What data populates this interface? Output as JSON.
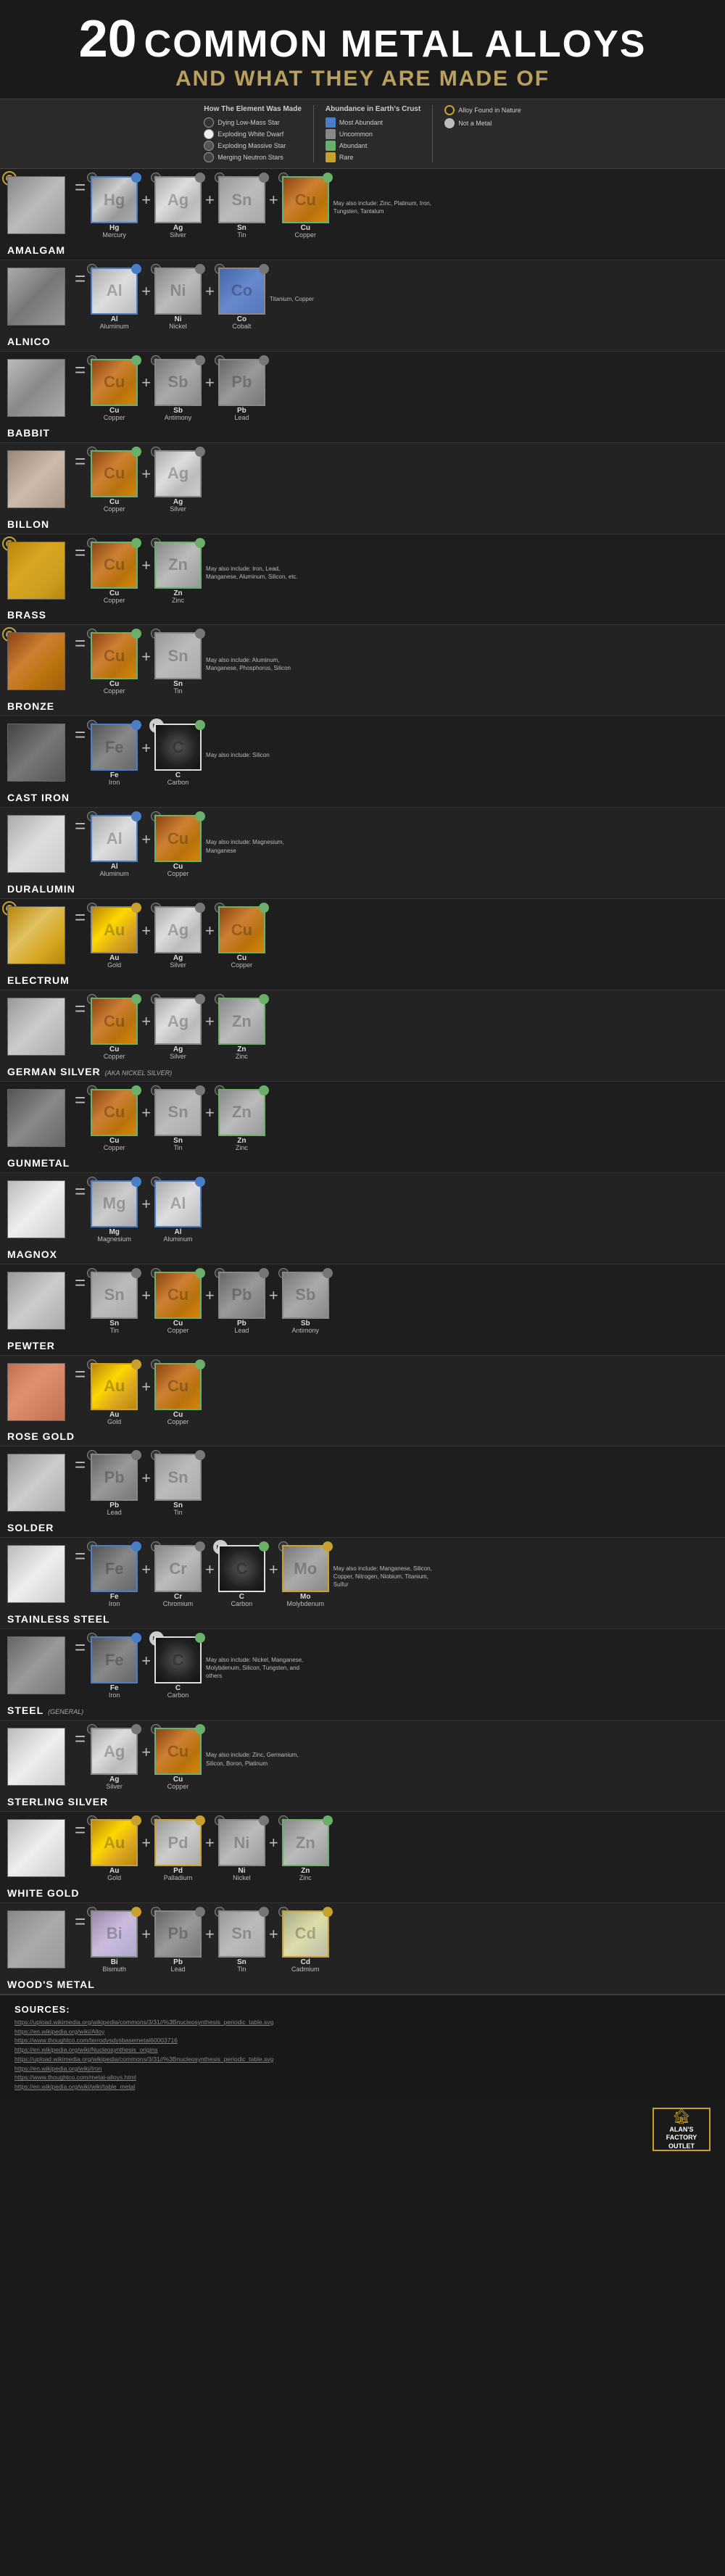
{
  "header": {
    "number": "20",
    "title": "COMMON METAL ALLOYS",
    "subtitle": "AND WHAT THEY ARE MADE OF"
  },
  "legend": {
    "how_title": "How The Element Was Made",
    "how_items": [
      {
        "label": "Dying Low-Mass Star",
        "icon": "circle-dark"
      },
      {
        "label": "Exploding White Dwarf",
        "icon": "circle-white"
      },
      {
        "label": "Exploding Massive Star",
        "icon": "circle-medium"
      },
      {
        "label": "Merging Neutron Stars",
        "icon": "circle-neutron"
      }
    ],
    "abundance_title": "Abundance in Earth's Crust",
    "abundance_items": [
      {
        "label": "Most Abundant",
        "color": "blue"
      },
      {
        "label": "Uncommon",
        "color": "gray"
      },
      {
        "label": "Abundant",
        "color": "green"
      },
      {
        "label": "Rare",
        "color": "gold"
      }
    ],
    "alloy_items": [
      {
        "label": "Alloy Found in Nature"
      },
      {
        "label": "Not a Metal"
      }
    ]
  },
  "alloy_found_label": "Alloy Found Nature Not Metal",
  "alloys": [
    {
      "name": "AMALGAM",
      "aka": "",
      "nature": true,
      "texture": "tex-amalgam",
      "elements": [
        {
          "sym": "Hg",
          "name": "Mercury",
          "tex": "tex-mercury",
          "border": "b-blue",
          "abund": "ad-blue",
          "how": "★"
        },
        {
          "sym": "Ag",
          "name": "Silver",
          "tex": "tex-silver",
          "border": "b-gray",
          "abund": "ad-gray",
          "how": "✦"
        },
        {
          "sym": "Sn",
          "name": "Tin",
          "tex": "tex-tin",
          "border": "b-gray",
          "abund": "ad-gray",
          "how": "✦"
        },
        {
          "sym": "Cu",
          "name": "Copper",
          "tex": "tex-copper",
          "border": "b-green",
          "abund": "ad-green",
          "how": "✦"
        }
      ],
      "may_also": "May also include: Zinc, Platinum, Iron, Tungsten, Tantalum"
    },
    {
      "name": "ALNICO",
      "aka": "",
      "nature": false,
      "texture": "tex-alnico",
      "elements": [
        {
          "sym": "Al",
          "name": "Aluminum",
          "tex": "tex-aluminum",
          "border": "b-blue",
          "abund": "ad-blue",
          "how": "★"
        },
        {
          "sym": "Ni",
          "name": "Nickel",
          "tex": "tex-nickel",
          "border": "b-gray",
          "abund": "ad-gray",
          "how": "✦"
        },
        {
          "sym": "Co",
          "name": "Cobalt",
          "tex": "tex-cobalt",
          "border": "b-gray",
          "abund": "ad-gray",
          "how": "✦"
        }
      ],
      "may_also": "Titanium, Copper"
    },
    {
      "name": "BABBIT",
      "aka": "",
      "nature": false,
      "texture": "tex-babbit",
      "elements": [
        {
          "sym": "Cu",
          "name": "Copper",
          "tex": "tex-copper",
          "border": "b-green",
          "abund": "ad-green",
          "how": "✦"
        },
        {
          "sym": "Sb",
          "name": "Antimony",
          "tex": "tex-antimony",
          "border": "b-gray",
          "abund": "ad-gray",
          "how": "✦"
        },
        {
          "sym": "Pb",
          "name": "Lead",
          "tex": "tex-lead",
          "border": "b-gray",
          "abund": "ad-gray",
          "how": "✦"
        }
      ],
      "may_also": ""
    },
    {
      "name": "BILLON",
      "aka": "",
      "nature": false,
      "texture": "tex-billon",
      "elements": [
        {
          "sym": "Cu",
          "name": "Copper",
          "tex": "tex-copper",
          "border": "b-green",
          "abund": "ad-green",
          "how": "✦"
        },
        {
          "sym": "Ag",
          "name": "Silver",
          "tex": "tex-silver",
          "border": "b-gray",
          "abund": "ad-gray",
          "how": "✦"
        }
      ],
      "may_also": ""
    },
    {
      "name": "BRASS",
      "aka": "",
      "nature": true,
      "texture": "tex-brass",
      "elements": [
        {
          "sym": "Cu",
          "name": "Copper",
          "tex": "tex-copper",
          "border": "b-green",
          "abund": "ad-green",
          "how": "✦"
        },
        {
          "sym": "Zn",
          "name": "Zinc",
          "tex": "tex-zinc",
          "border": "b-green",
          "abund": "ad-green",
          "how": "✦"
        }
      ],
      "may_also": "May also include: Iron, Lead, Manganese, Aluminum, Silicon, etc."
    },
    {
      "name": "BRONZE",
      "aka": "",
      "nature": true,
      "texture": "tex-bronze",
      "elements": [
        {
          "sym": "Cu",
          "name": "Copper",
          "tex": "tex-copper",
          "border": "b-green",
          "abund": "ad-green",
          "how": "✦"
        },
        {
          "sym": "Sn",
          "name": "Tin",
          "tex": "tex-tin",
          "border": "b-gray",
          "abund": "ad-gray",
          "how": "✦"
        }
      ],
      "may_also": "May also include: Aluminum, Manganese, Phosphorus, Silicon"
    },
    {
      "name": "CAST IRON",
      "aka": "",
      "nature": false,
      "texture": "tex-cast-iron",
      "elements": [
        {
          "sym": "Fe",
          "name": "Iron",
          "tex": "tex-iron",
          "border": "b-blue",
          "abund": "ad-blue",
          "how": "★"
        },
        {
          "sym": "C",
          "name": "Carbon",
          "tex": "tex-carbon",
          "border": "b-white",
          "abund": "ad-green",
          "how": "★",
          "not_metal": true
        }
      ],
      "may_also": "May also include: Silicon"
    },
    {
      "name": "DURALUMIN",
      "aka": "",
      "nature": false,
      "texture": "tex-duralumin",
      "elements": [
        {
          "sym": "Al",
          "name": "Aluminum",
          "tex": "tex-aluminum",
          "border": "b-blue",
          "abund": "ad-blue",
          "how": "★"
        },
        {
          "sym": "Cu",
          "name": "Copper",
          "tex": "tex-copper",
          "border": "b-green",
          "abund": "ad-green",
          "how": "✦"
        }
      ],
      "may_also": "May also include: Magnesium, Manganese"
    },
    {
      "name": "ELECTRUM",
      "aka": "",
      "nature": true,
      "texture": "tex-electrum",
      "elements": [
        {
          "sym": "Au",
          "name": "Gold",
          "tex": "tex-gold",
          "border": "b-gray",
          "abund": "ad-gold",
          "how": "✦"
        },
        {
          "sym": "Ag",
          "name": "Silver",
          "tex": "tex-silver",
          "border": "b-gray",
          "abund": "ad-gray",
          "how": "✦"
        },
        {
          "sym": "Cu",
          "name": "Copper",
          "tex": "tex-copper",
          "border": "b-green",
          "abund": "ad-green",
          "how": "✦"
        }
      ],
      "may_also": ""
    },
    {
      "name": "GERMAN SILVER",
      "aka": "(AKA NICKEL SILVER)",
      "nature": false,
      "texture": "tex-german-silver",
      "elements": [
        {
          "sym": "Cu",
          "name": "Copper",
          "tex": "tex-copper",
          "border": "b-green",
          "abund": "ad-green",
          "how": "✦"
        },
        {
          "sym": "Ag",
          "name": "Silver",
          "tex": "tex-silver",
          "border": "b-gray",
          "abund": "ad-gray",
          "how": "✦"
        },
        {
          "sym": "Zn",
          "name": "Zinc",
          "tex": "tex-zinc",
          "border": "b-green",
          "abund": "ad-green",
          "how": "✦"
        }
      ],
      "may_also": ""
    },
    {
      "name": "GUNMETAL",
      "aka": "",
      "nature": false,
      "texture": "tex-gunmetal",
      "elements": [
        {
          "sym": "Cu",
          "name": "Copper",
          "tex": "tex-copper",
          "border": "b-green",
          "abund": "ad-green",
          "how": "✦"
        },
        {
          "sym": "Sn",
          "name": "Tin",
          "tex": "tex-tin",
          "border": "b-gray",
          "abund": "ad-gray",
          "how": "✦"
        },
        {
          "sym": "Zn",
          "name": "Zinc",
          "tex": "tex-zinc",
          "border": "b-green",
          "abund": "ad-green",
          "how": "✦"
        }
      ],
      "may_also": ""
    },
    {
      "name": "MAGNOX",
      "aka": "",
      "nature": false,
      "texture": "tex-magnox",
      "elements": [
        {
          "sym": "Mg",
          "name": "Magnesium",
          "tex": "tex-magnesium",
          "border": "b-blue",
          "abund": "ad-blue",
          "how": "✦"
        },
        {
          "sym": "Al",
          "name": "Aluminum",
          "tex": "tex-aluminum",
          "border": "b-blue",
          "abund": "ad-blue",
          "how": "★"
        }
      ],
      "may_also": ""
    },
    {
      "name": "PEWTER",
      "aka": "",
      "nature": false,
      "texture": "tex-pewter",
      "elements": [
        {
          "sym": "Sn",
          "name": "Tin",
          "tex": "tex-tin",
          "border": "b-gray",
          "abund": "ad-gray",
          "how": "✦"
        },
        {
          "sym": "Cu",
          "name": "Copper",
          "tex": "tex-copper",
          "border": "b-green",
          "abund": "ad-green",
          "how": "✦"
        },
        {
          "sym": "Pb",
          "name": "Lead",
          "tex": "tex-lead",
          "border": "b-gray",
          "abund": "ad-gray",
          "how": "✦"
        },
        {
          "sym": "Sb",
          "name": "Antimony",
          "tex": "tex-antimony",
          "border": "b-gray",
          "abund": "ad-gray",
          "how": "✦"
        }
      ],
      "may_also": ""
    },
    {
      "name": "ROSE GOLD",
      "aka": "",
      "nature": false,
      "texture": "tex-rose-gold",
      "elements": [
        {
          "sym": "Au",
          "name": "Gold",
          "tex": "tex-gold",
          "border": "b-gold",
          "abund": "ad-gold",
          "how": "✦"
        },
        {
          "sym": "Cu",
          "name": "Copper",
          "tex": "tex-copper",
          "border": "b-green",
          "abund": "ad-green",
          "how": "✦"
        }
      ],
      "may_also": ""
    },
    {
      "name": "SOLDER",
      "aka": "",
      "nature": false,
      "texture": "tex-solder",
      "elements": [
        {
          "sym": "Pb",
          "name": "Lead",
          "tex": "tex-lead",
          "border": "b-gray",
          "abund": "ad-gray",
          "how": "✦"
        },
        {
          "sym": "Sn",
          "name": "Tin",
          "tex": "tex-tin",
          "border": "b-gray",
          "abund": "ad-gray",
          "how": "✦"
        }
      ],
      "may_also": ""
    },
    {
      "name": "STAINLESS STEEL",
      "aka": "",
      "nature": false,
      "texture": "tex-stainless",
      "elements": [
        {
          "sym": "Fe",
          "name": "Iron",
          "tex": "tex-iron",
          "border": "b-blue",
          "abund": "ad-blue",
          "how": "★"
        },
        {
          "sym": "Cr",
          "name": "Chromium",
          "tex": "tex-chromium",
          "border": "b-gray",
          "abund": "ad-gray",
          "how": "★"
        },
        {
          "sym": "C",
          "name": "Carbon",
          "tex": "tex-carbon",
          "border": "b-white",
          "abund": "ad-green",
          "how": "★",
          "not_metal": true
        },
        {
          "sym": "Mo",
          "name": "Molybdenum",
          "tex": "tex-molybdenum",
          "border": "b-gold",
          "abund": "ad-gold",
          "how": "✦"
        }
      ],
      "may_also": "May also include: Manganese, Silicon, Copper, Nitrogen, Niobium, Titanium, Sulfur"
    },
    {
      "name": "STEEL",
      "aka": "(GENERAL)",
      "nature": false,
      "texture": "tex-steel",
      "elements": [
        {
          "sym": "Fe",
          "name": "Iron",
          "tex": "tex-iron",
          "border": "b-blue",
          "abund": "ad-blue",
          "how": "★"
        },
        {
          "sym": "C",
          "name": "Carbon",
          "tex": "tex-carbon",
          "border": "b-white",
          "abund": "ad-green",
          "how": "★",
          "not_metal": true
        }
      ],
      "may_also": "May also include: Nickel, Manganese, Molybdenum, Silicon, Tungsten, and others"
    },
    {
      "name": "STERLING SILVER",
      "aka": "",
      "nature": false,
      "texture": "tex-sterling",
      "elements": [
        {
          "sym": "Ag",
          "name": "Silver",
          "tex": "tex-silver",
          "border": "b-gray",
          "abund": "ad-gray",
          "how": "✦"
        },
        {
          "sym": "Cu",
          "name": "Copper",
          "tex": "tex-copper",
          "border": "b-green",
          "abund": "ad-green",
          "how": "✦"
        }
      ],
      "may_also": "May also include: Zinc, Germanium, Silicon, Boron, Platinum"
    },
    {
      "name": "WHITE GOLD",
      "aka": "",
      "nature": false,
      "texture": "tex-white-gold",
      "elements": [
        {
          "sym": "Au",
          "name": "Gold",
          "tex": "tex-gold",
          "border": "b-gold",
          "abund": "ad-gold",
          "how": "✦"
        },
        {
          "sym": "Pd",
          "name": "Palladium",
          "tex": "tex-palladium",
          "border": "b-gold",
          "abund": "ad-gold",
          "how": "✦"
        },
        {
          "sym": "Ni",
          "name": "Nickel",
          "tex": "tex-nickel",
          "border": "b-gray",
          "abund": "ad-gray",
          "how": "✦"
        },
        {
          "sym": "Zn",
          "name": "Zinc",
          "tex": "tex-zinc",
          "border": "b-green",
          "abund": "ad-green",
          "how": "✦"
        }
      ],
      "may_also": ""
    },
    {
      "name": "WOOD'S METAL",
      "aka": "",
      "nature": false,
      "texture": "tex-woods",
      "elements": [
        {
          "sym": "Bi",
          "name": "Bismuth",
          "tex": "tex-bismuth",
          "border": "b-gray",
          "abund": "ad-gold",
          "how": "✦"
        },
        {
          "sym": "Pb",
          "name": "Lead",
          "tex": "tex-lead",
          "border": "b-gray",
          "abund": "ad-gray",
          "how": "✦"
        },
        {
          "sym": "Sn",
          "name": "Tin",
          "tex": "tex-tin",
          "border": "b-gray",
          "abund": "ad-gray",
          "how": "✦"
        },
        {
          "sym": "Cd",
          "name": "Cadmium",
          "tex": "tex-cadmium",
          "border": "b-gold",
          "abund": "ad-gold",
          "how": "✦"
        }
      ],
      "may_also": ""
    }
  ],
  "sources": {
    "title": "SOURCES:",
    "links": [
      "https://upload.wikimedia.org/wikipedia/commons/3/31//%3Bnucleosynthesis_periodic_table.svg",
      "https://en.wikipedia.org/wiki/Alloy",
      "https://www.thoughtco.com/terrodysdysbasemetal60003716",
      "https://en.wikipedia.org/wiki/Nucleosynthesis_origins",
      "https://upload.wikimedia.org/wikipedia/commons/3/31//%3Bnucleosynthesis_periodic_table.svg",
      "https://en.wikipedia.org/wiki/Iron",
      "https://www.thoughtco.com/metal-alloys.html",
      "https://en.wikipedia.org/wiki/wiki/table_metal"
    ]
  },
  "brand": {
    "name": "Alan's\nFactory Outlet"
  }
}
